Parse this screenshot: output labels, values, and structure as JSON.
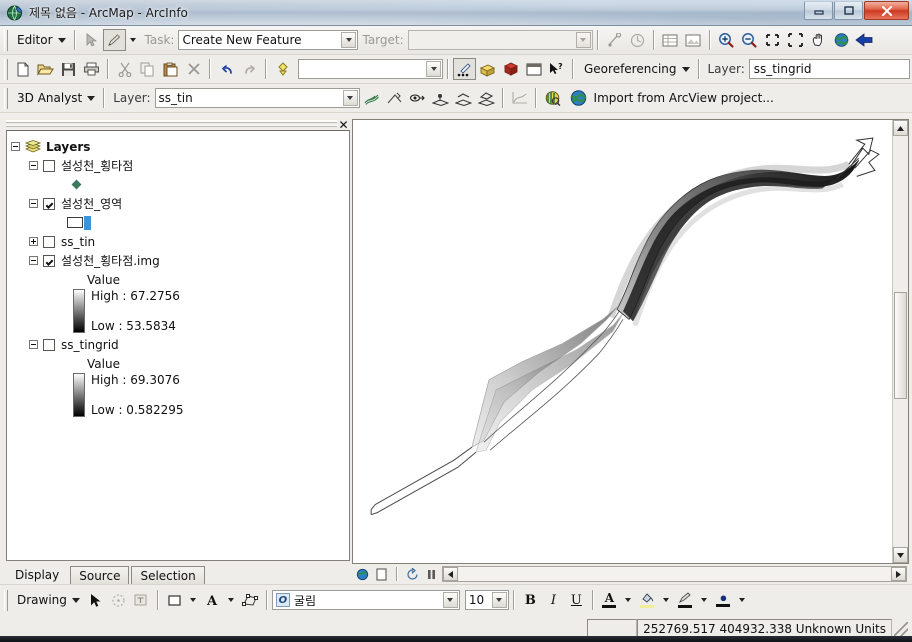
{
  "window": {
    "title": "제목 없음 - ArcMap - ArcInfo",
    "app_icon": "arcmap-globe-icon",
    "minimize_label": "—",
    "maximize_label": "❐",
    "close_label": "✕"
  },
  "editor_toolbar": {
    "menu_label": "Editor",
    "sketch_tool_icon": "edit-sketch-pencil-icon",
    "arrow_tool_icon": "edit-arrow-icon",
    "task_label": "Task:",
    "task_value": "Create New Feature",
    "target_label": "Target:",
    "target_value": "",
    "buttons": [
      {
        "name": "attributes-icon",
        "glyph": "⌁"
      },
      {
        "name": "sketch-properties-icon",
        "glyph": "◷"
      },
      {
        "name": "attribute-table-icon",
        "glyph": "▤"
      },
      {
        "name": "metadata-icon",
        "glyph": "▣"
      }
    ],
    "nav_buttons": [
      {
        "name": "zoom-in-icon",
        "glyph": "+"
      },
      {
        "name": "zoom-out-icon",
        "glyph": "−"
      },
      {
        "name": "fixed-zoom-in-icon",
        "glyph": "✛"
      },
      {
        "name": "fixed-zoom-out-icon",
        "glyph": "✢"
      },
      {
        "name": "pan-hand-icon",
        "glyph": "✋"
      },
      {
        "name": "full-extent-globe-icon",
        "glyph": "🌐"
      },
      {
        "name": "go-back-extent-icon",
        "glyph": "⬅"
      }
    ]
  },
  "standard_toolbar": {
    "buttons": [
      {
        "name": "new-document-icon",
        "glyph": "📄"
      },
      {
        "name": "open-folder-icon",
        "glyph": "📂"
      },
      {
        "name": "save-icon",
        "glyph": "💾"
      },
      {
        "name": "print-icon",
        "glyph": "🖨"
      },
      {
        "name": "cut-icon",
        "glyph": "✂"
      },
      {
        "name": "copy-icon",
        "glyph": "⧉"
      },
      {
        "name": "paste-icon",
        "glyph": "📋"
      },
      {
        "name": "delete-icon",
        "glyph": "✕"
      },
      {
        "name": "undo-icon",
        "glyph": "↶"
      },
      {
        "name": "redo-icon",
        "glyph": "↷"
      },
      {
        "name": "add-data-icon",
        "glyph": "✥"
      }
    ],
    "scale_value": "",
    "georef_buttons": [
      {
        "name": "editor-points-icon",
        "glyph": "⋰"
      },
      {
        "name": "toolbox-icon",
        "glyph": "🧰"
      },
      {
        "name": "model-builder-icon",
        "glyph": "📕"
      },
      {
        "name": "command-line-icon",
        "glyph": "▭"
      },
      {
        "name": "whats-this-help-icon",
        "glyph": "?"
      }
    ],
    "georeferencing_label": "Georeferencing",
    "layer_label": "Layer:",
    "layer_value": "ss_tingrid"
  },
  "analyst_toolbar": {
    "menu_label": "3D Analyst",
    "layer_label": "Layer:",
    "layer_value": "ss_tin",
    "buttons": [
      {
        "name": "contour-icon",
        "glyph": "◍"
      },
      {
        "name": "steepest-path-icon",
        "glyph": "⟋"
      },
      {
        "name": "line-of-sight-icon",
        "glyph": "👁"
      },
      {
        "name": "interpolate-point-icon",
        "glyph": "⬡"
      },
      {
        "name": "interpolate-line-icon",
        "glyph": "⬢"
      },
      {
        "name": "interpolate-polygon-icon",
        "glyph": "⬣"
      },
      {
        "name": "profile-graph-icon",
        "glyph": "📈"
      },
      {
        "name": "arcscene-icon",
        "glyph": "🗺"
      }
    ],
    "import_label": "Import from ArcView project...",
    "import_icon": "arcview-globe-icon"
  },
  "toc": {
    "panel_close_label": "✕",
    "root": {
      "label": "Layers",
      "icon": "layers-stack-icon",
      "expanded": true
    },
    "layers": [
      {
        "label": "설성천_횡타점",
        "checked": false,
        "expanded": true,
        "symbol": "point-diamond-symbol"
      },
      {
        "label": "설성천_영역",
        "checked": true,
        "expanded": true,
        "symbol": "polygon-outline-symbol"
      },
      {
        "label": "ss_tin",
        "checked": false,
        "expanded": false,
        "symbol": "none"
      },
      {
        "label": "설성천_횡타점.img",
        "checked": true,
        "expanded": true,
        "value_label": "Value",
        "high_label": "High : 67.2756",
        "low_label": "Low : 53.5834"
      },
      {
        "label": "ss_tingrid",
        "checked": false,
        "expanded": true,
        "value_label": "Value",
        "high_label": "High : 69.3076",
        "low_label": "Low : 0.582295"
      }
    ],
    "tabs": [
      {
        "label": "Display",
        "active": true
      },
      {
        "label": "Source",
        "active": false
      },
      {
        "label": "Selection",
        "active": false
      }
    ]
  },
  "map_view": {
    "bottom_buttons": [
      {
        "name": "data-view-icon",
        "glyph": "◍"
      },
      {
        "name": "layout-view-icon",
        "glyph": "▯"
      },
      {
        "name": "refresh-view-icon",
        "glyph": "⟳"
      },
      {
        "name": "pause-drawing-icon",
        "glyph": "❙❙"
      }
    ],
    "scroll_left_label": "◀",
    "scroll_right_label": "▶",
    "scroll_up_label": "▲",
    "scroll_down_label": "▼"
  },
  "drawing_toolbar": {
    "menu_label": "Drawing",
    "select_icon": "select-arrow-icon",
    "rotate_icon": "rotate-element-icon",
    "edit_vertices_icon": "edit-vertices-icon",
    "fill_color_icon": "fill-color-swatch-icon",
    "text_icon": "text-letter-A-icon",
    "new-text-icon": "new-text-icon",
    "font_badge": "O",
    "font_name": "굴림",
    "font_size": "10",
    "bold_label": "B",
    "italic_label": "I",
    "underline_label": "U",
    "font_color_label": "A",
    "fill_color_label": "◇",
    "line_color_label": "✎",
    "marker_color_label": "●"
  },
  "status_bar": {
    "coordinates": "252769.517  404932.338 Unknown Units"
  },
  "colors": {
    "title_bar": "#b6c4d4",
    "close_button": "#cc3a22",
    "toolbar_bg": "#eeedea",
    "map_bg": "#ffffff",
    "ramp_high": "#ffffff",
    "ramp_low": "#000000",
    "polygon_bar": "#3d93d8",
    "point_symbol": "#3b7a5e"
  }
}
